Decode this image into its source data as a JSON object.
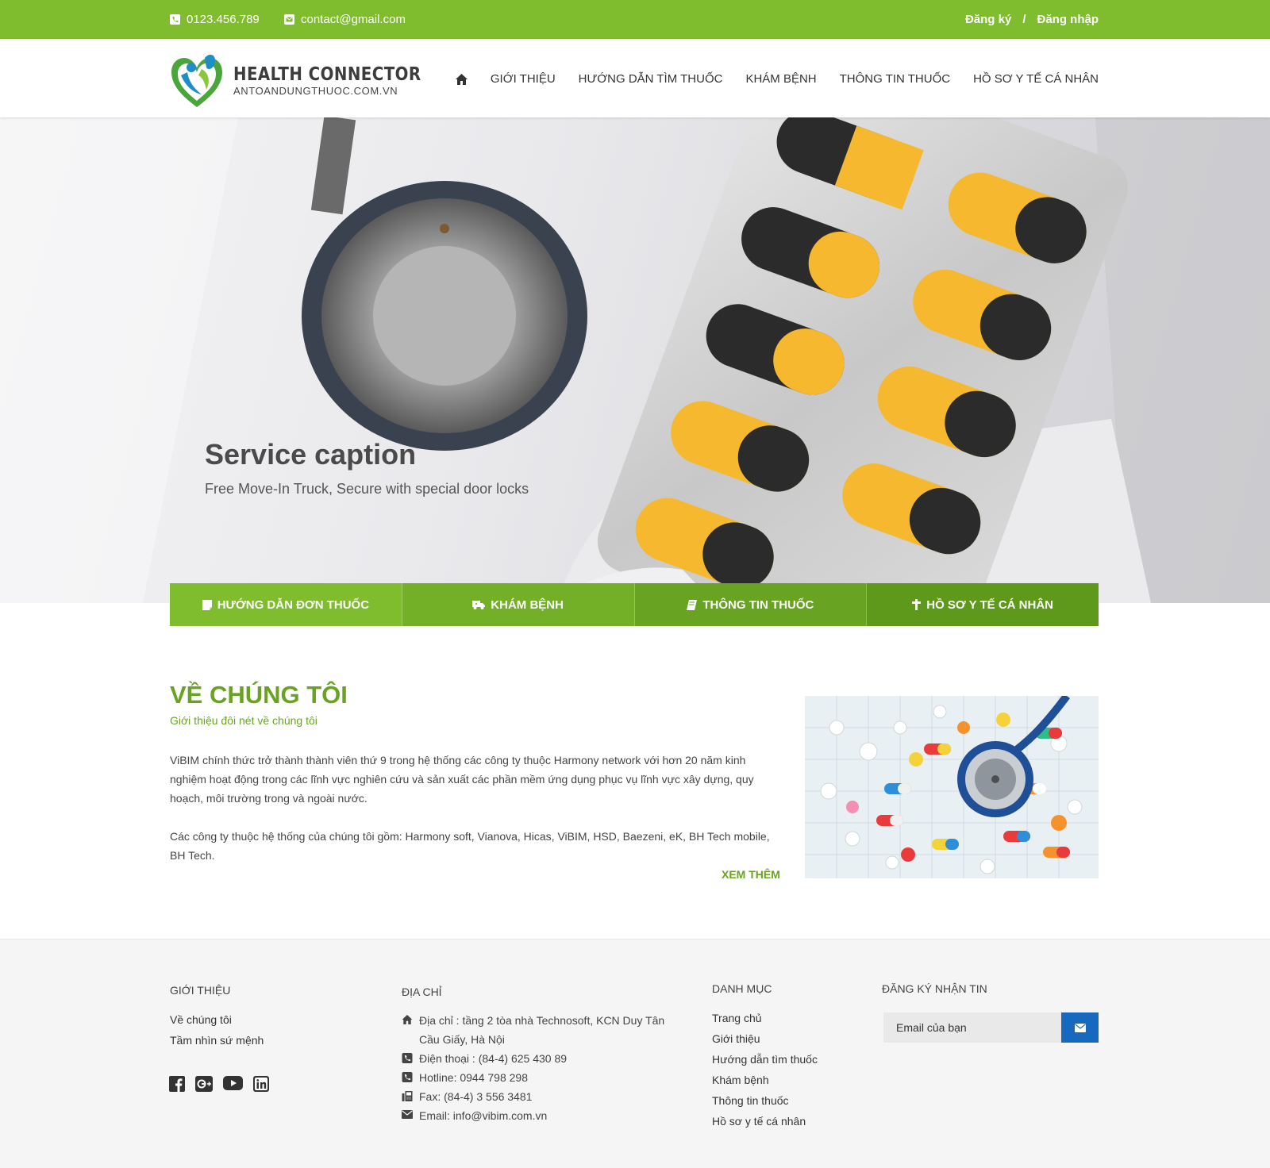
{
  "topbar": {
    "phone": "0123.456.789",
    "email": "contact@gmail.com",
    "register": "Đăng ký",
    "separator": "/",
    "login": "Đăng nhập",
    "bg_color": "#7fbd2f"
  },
  "header": {
    "logo_title": "HEALTH CONNECTOR",
    "logo_subtitle": "ANTOANDUNGTHUOC.COM.VN",
    "nav": [
      "GIỚI THIỆU",
      "HƯỚNG DẪN TÌM THUỐC",
      "KHÁM BỆNH",
      "THÔNG TIN THUỐC",
      "HỒ SƠ Y TẾ CÁ NHÂN"
    ],
    "home_icon": "home-icon"
  },
  "hero": {
    "title": "Service caption",
    "subtitle": "Free Move-In Truck, Secure with special door locks"
  },
  "tabs": [
    {
      "label": "HƯỚNG DẪN ĐƠN THUỐC",
      "icon": "note-icon",
      "color": "#7fbd2f"
    },
    {
      "label": "KHÁM BỆNH",
      "icon": "ambulance-icon",
      "color": "#73b027"
    },
    {
      "label": "THÔNG TIN THUỐC",
      "icon": "book-icon",
      "color": "#68a421"
    },
    {
      "label": "HỒ SƠ Y TẾ CÁ NHÂN",
      "icon": "medical-icon",
      "color": "#5e991b"
    }
  ],
  "about": {
    "title": "VỀ CHÚNG TÔI",
    "subtitle": "Giới thiệu đôi nét về chúng tôi",
    "p1": "ViBIM chính thức trở thành thành viên thứ 9 trong hệ thống các công ty thuộc Harmony network với hơn 20 năm kinh nghiệm hoạt động trong các lĩnh vực nghiên cứu và sản xuất các phần mềm ứng dụng phục vụ lĩnh vực xây dựng, quy hoạch, môi trường trong và ngoài nước.",
    "p2": "Các công ty thuộc hệ thống của chúng tôi gồm: Harmony soft, Vianova, Hicas, ViBIM, HSD, Baezeni, eK, BH Tech mobile, BH Tech.",
    "more": "XEM THÊM",
    "accent": "#6aa324"
  },
  "footer": {
    "intro": {
      "heading": "GIỚI THIỆU",
      "links": [
        "Về chúng tôi",
        "Tầm nhìn sứ mệnh"
      ]
    },
    "social": [
      "facebook-icon",
      "google-plus-icon",
      "youtube-icon",
      "linkedin-icon"
    ],
    "address": {
      "heading": "ĐỊA CHỈ",
      "line1": "Địa chỉ : tầng 2 tòa nhà Technosoft, KCN Duy Tân",
      "line1b": "Cầu Giấy, Hà Nội",
      "phone": "Điện thoại : (84-4) 625 430 89",
      "hotline": "Hotline: 0944 798 298",
      "fax": "Fax: (84-4) 3 556 3481",
      "email": "Email: info@vibim.com.vn"
    },
    "categories": {
      "heading": "DANH MỤC",
      "links": [
        "Trang chủ",
        "Giới thiệu",
        "Hướng dẫn tìm thuốc",
        "Khám bệnh",
        "Thông tin thuốc",
        "Hồ sơ y tế cá nhân"
      ]
    },
    "newsletter": {
      "heading": "ĐĂNG KÝ NHẬN TIN",
      "placeholder": "Email của bạn",
      "button_color": "#1769bf"
    }
  }
}
